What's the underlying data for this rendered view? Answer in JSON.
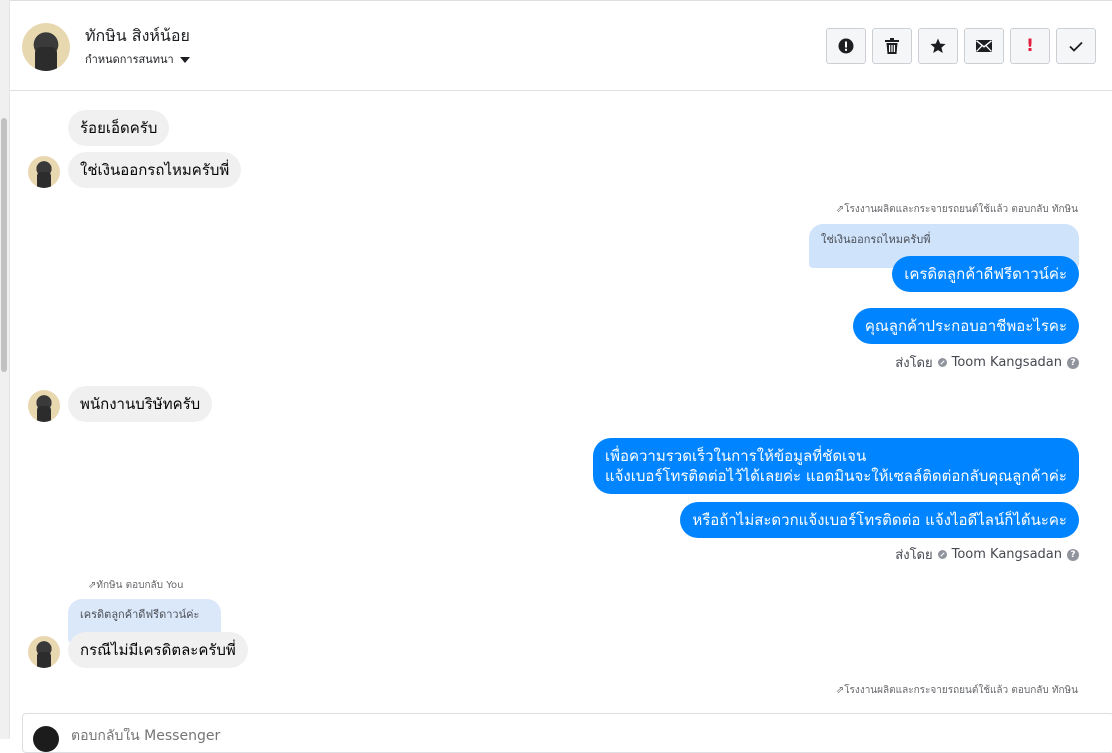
{
  "header": {
    "contact_name": "ทักษิน สิงห์น้อย",
    "conversation_settings": "กำหนดการสนทนา",
    "toolbar": [
      {
        "icon": "alert-circle-icon",
        "name": "mark-spam-button"
      },
      {
        "icon": "trash-icon",
        "name": "delete-button"
      },
      {
        "icon": "star-icon",
        "name": "star-button"
      },
      {
        "icon": "envelope-icon",
        "name": "mark-unread-button"
      },
      {
        "icon": "exclamation-icon",
        "name": "follow-up-button",
        "glyph": "!"
      },
      {
        "icon": "check-icon",
        "name": "mark-done-button"
      }
    ],
    "accent_exclamation": "#e41e3f"
  },
  "messages": {
    "m1": "ร้อยเอ็ดครับ",
    "m2": "ใช่เงินออกรถไหมครับพี่",
    "reply_meta_1": "โรงงานผลิตและกระจายรถยนต์ใช้แล้ว ตอบกลับ ทักษิน",
    "quote_1": "ใช่เงินออกรถไหมครับพี่",
    "m3": "เครดิตลูกค้าดีฟรีดาวน์ค่ะ",
    "m4": "คุณลูกค้าประกอบอาชีพอะไรคะ",
    "sent_by_label_1": "ส่งโดย",
    "sent_by_name_1": "Toom Kangsadan",
    "m5": "พนักงานบริษัทครับ",
    "m6_line1": "เพื่อความรวดเร็วในการให้ข้อมูลที่ชัดเจน",
    "m6_line2": "แจ้งเบอร์โทรติดต่อไว้ได้เลยค่ะ แอดมินจะให้เซลล์ติดต่อกลับคุณลูกค้าค่ะ",
    "m7": "หรือถ้าไม่สะดวกแจ้งเบอร์โทรติดต่อ แจ้งไอดีไลน์ก็ได้นะคะ",
    "sent_by_label_2": "ส่งโดย",
    "sent_by_name_2": "Toom Kangsadan",
    "reply_meta_2": "ทักษิน ตอบกลับ You",
    "quote_2": "เครดิตลูกค้าดีฟรีดาวน์ค่ะ",
    "m8": "กรณีไม่มีเครดิตละครับพี่",
    "reply_meta_3": "โรงงานผลิตและกระจายรถยนต์ใช้แล้ว ตอบกลับ ทักษิน"
  },
  "composer": {
    "placeholder": "ตอบกลับใน Messenger"
  },
  "colors": {
    "outgoing_bubble": "#0084ff",
    "incoming_bubble": "#f0f0f0",
    "quote_bubble": "#cfe3fb"
  }
}
